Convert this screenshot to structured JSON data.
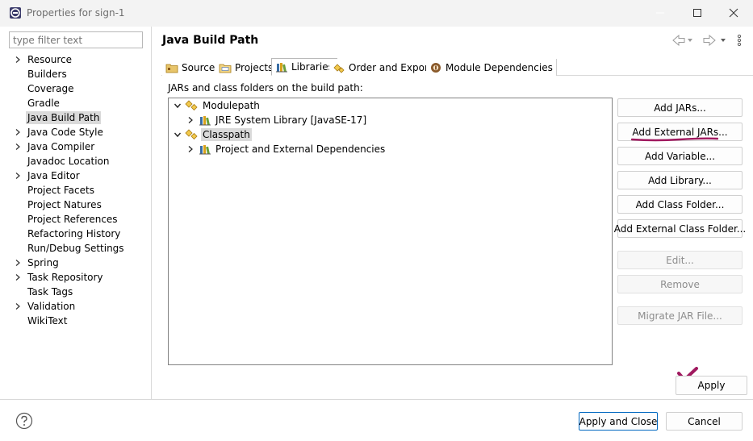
{
  "window": {
    "title": "Properties for sign-1"
  },
  "filter": {
    "placeholder": "type filter text"
  },
  "nav": {
    "items": [
      {
        "label": "Resource",
        "expandable": true
      },
      {
        "label": "Builders",
        "expandable": false
      },
      {
        "label": "Coverage",
        "expandable": false
      },
      {
        "label": "Gradle",
        "expandable": false
      },
      {
        "label": "Java Build Path",
        "expandable": false,
        "selected": true
      },
      {
        "label": "Java Code Style",
        "expandable": true
      },
      {
        "label": "Java Compiler",
        "expandable": true
      },
      {
        "label": "Javadoc Location",
        "expandable": false
      },
      {
        "label": "Java Editor",
        "expandable": true
      },
      {
        "label": "Project Facets",
        "expandable": false
      },
      {
        "label": "Project Natures",
        "expandable": false
      },
      {
        "label": "Project References",
        "expandable": false
      },
      {
        "label": "Refactoring History",
        "expandable": false
      },
      {
        "label": "Run/Debug Settings",
        "expandable": false
      },
      {
        "label": "Spring",
        "expandable": true
      },
      {
        "label": "Task Repository",
        "expandable": true
      },
      {
        "label": "Task Tags",
        "expandable": false
      },
      {
        "label": "Validation",
        "expandable": true
      },
      {
        "label": "WikiText",
        "expandable": false
      }
    ]
  },
  "page": {
    "title": "Java Build Path"
  },
  "tabs": [
    {
      "label": "Source",
      "icon": "source-folder-icon"
    },
    {
      "label": "Projects",
      "icon": "projects-icon"
    },
    {
      "label": "Libraries",
      "icon": "libraries-icon",
      "active": true
    },
    {
      "label": "Order and Export",
      "icon": "order-export-icon"
    },
    {
      "label": "Module Dependencies",
      "icon": "module-dependencies-icon"
    }
  ],
  "libraries": {
    "caption": "JARs and class folders on the build path:",
    "tree": {
      "modulepath": "Modulepath",
      "jre": "JRE System Library [JavaSE-17]",
      "classpath": "Classpath",
      "project_deps": "Project and External Dependencies"
    }
  },
  "buttons": {
    "add_jars": "Add JARs...",
    "add_external_jars": "Add External JARs...",
    "add_variable": "Add Variable...",
    "add_library": "Add Library...",
    "add_class_folder": "Add Class Folder...",
    "add_external_class_folder": "Add External Class Folder...",
    "edit": "Edit...",
    "remove": "Remove",
    "migrate_jar": "Migrate JAR File...",
    "apply": "Apply",
    "apply_and_close": "Apply and Close",
    "cancel": "Cancel"
  },
  "colors": {
    "annotation": "#a0195f",
    "selection": "#dadada",
    "default_button_border": "#0067c0"
  }
}
